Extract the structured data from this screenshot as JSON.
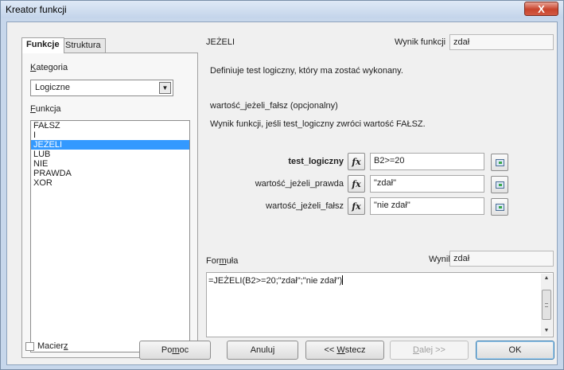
{
  "window": {
    "title": "Kreator funkcji",
    "close_label": "X"
  },
  "tabs": [
    {
      "label": "Funkcje",
      "active": true
    },
    {
      "label": "Struktura",
      "active": false
    }
  ],
  "category": {
    "label_pre": "",
    "label_u": "K",
    "label_post": "ategoria",
    "selected": "Logiczne"
  },
  "function_list": {
    "label_pre": "",
    "label_u": "F",
    "label_post": "unkcja",
    "items": [
      "FAŁSZ",
      "I",
      "JEŻELI",
      "LUB",
      "NIE",
      "PRAWDA",
      "XOR"
    ],
    "selected_index": 2
  },
  "function": {
    "name": "JEŻELI",
    "result_label": "Wynik funkcji",
    "result_value": "zdał",
    "description": "Definiuje test logiczny, który ma zostać wykonany.",
    "param_title": "wartość_jeżeli_fałsz (opcjonalny)",
    "param_desc": "Wynik funkcji, jeśli test_logiczny zwróci wartość FAŁSZ."
  },
  "arguments": [
    {
      "label": "test_logiczny",
      "value": "B2>=20",
      "bold": true
    },
    {
      "label": "wartość_jeżeli_prawda",
      "value": "\"zdał\"",
      "bold": false
    },
    {
      "label": "wartość_jeżeli_fałsz",
      "value": "\"nie zdał\"",
      "bold": false
    }
  ],
  "formula": {
    "label_pre": "For",
    "label_u": "m",
    "label_post": "uła",
    "result_label": "Wynik",
    "result_value": "zdał",
    "text": "=JEŻELI(B2>=20;\"zdał\";\"nie zdał\")"
  },
  "array": {
    "label_pre": "Macier",
    "label_u": "z",
    "label_post": "",
    "checked": false
  },
  "buttons": {
    "help": {
      "pre": "Po",
      "u": "m",
      "post": "oc"
    },
    "cancel": "Anuluj",
    "back": {
      "pre": "<< ",
      "u": "W",
      "post": "stecz"
    },
    "next": {
      "pre": "",
      "u": "D",
      "post": "alej >>"
    },
    "ok": "OK"
  }
}
